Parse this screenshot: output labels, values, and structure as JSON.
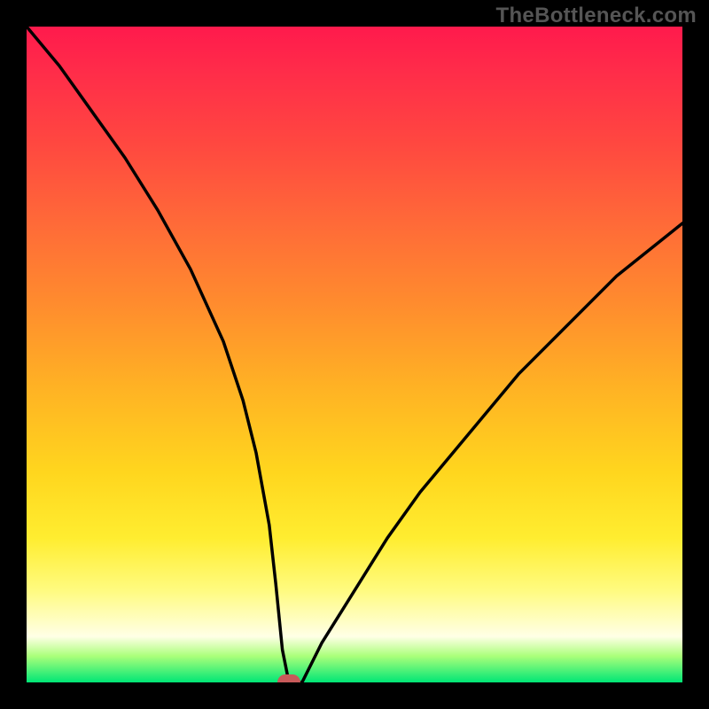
{
  "watermark": "TheBottleneck.com",
  "chart_data": {
    "type": "line",
    "title": "",
    "xlabel": "",
    "ylabel": "",
    "xlim": [
      0,
      100
    ],
    "ylim": [
      0,
      100
    ],
    "grid": false,
    "series": [
      {
        "name": "bottleneck-curve",
        "x": [
          0,
          5,
          10,
          15,
          20,
          25,
          30,
          33,
          35,
          37,
          38,
          39,
          40,
          42,
          45,
          50,
          55,
          60,
          65,
          70,
          75,
          80,
          85,
          90,
          95,
          100
        ],
        "values": [
          100,
          94,
          87,
          80,
          72,
          63,
          52,
          43,
          35,
          24,
          15,
          5,
          0,
          0,
          6,
          14,
          22,
          29,
          35,
          41,
          47,
          52,
          57,
          62,
          66,
          70
        ]
      }
    ],
    "markers": [
      {
        "name": "selected-point",
        "x": 40,
        "y": 0,
        "color": "#c85a5a"
      }
    ],
    "gradient_stops": [
      {
        "pct": 0,
        "color": "#ff1a4c"
      },
      {
        "pct": 6,
        "color": "#ff2a4a"
      },
      {
        "pct": 18,
        "color": "#ff4840"
      },
      {
        "pct": 30,
        "color": "#ff6a38"
      },
      {
        "pct": 42,
        "color": "#ff8b2e"
      },
      {
        "pct": 55,
        "color": "#ffb224"
      },
      {
        "pct": 68,
        "color": "#ffd61e"
      },
      {
        "pct": 78,
        "color": "#ffed30"
      },
      {
        "pct": 86,
        "color": "#fffb80"
      },
      {
        "pct": 93,
        "color": "#ffffe6"
      },
      {
        "pct": 96,
        "color": "#aaff7a"
      },
      {
        "pct": 100,
        "color": "#00e676"
      }
    ]
  }
}
